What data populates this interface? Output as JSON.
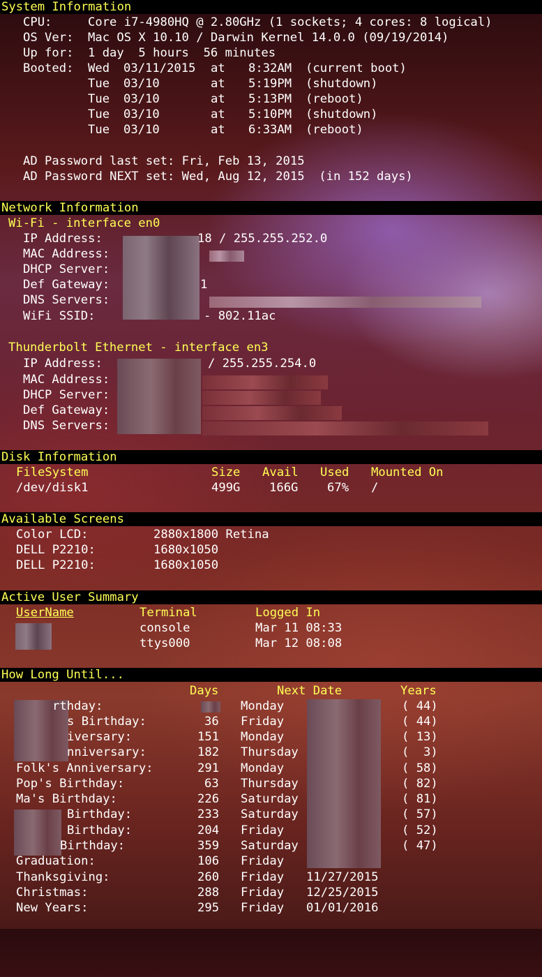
{
  "system": {
    "title": "System Information",
    "cpu_label": "CPU:",
    "cpu_value": "Core i7-4980HQ @ 2.80GHz (1 sockets; 4 cores: 8 logical)",
    "os_label": "OS Ver:",
    "os_value": "Mac OS X 10.10 / Darwin Kernel 14.0.0 (09/19/2014)",
    "up_label": "Up for:",
    "up_value": "1 day  5 hours  56 minutes",
    "booted_label": "Booted:",
    "boots": [
      {
        "day": "Wed",
        "date": "03/11/2015",
        "at": "at",
        "time": "8:32AM",
        "note": "(current boot)"
      },
      {
        "day": "Tue",
        "date": "03/10",
        "at": "at",
        "time": "5:19PM",
        "note": "(shutdown)"
      },
      {
        "day": "Tue",
        "date": "03/10",
        "at": "at",
        "time": "5:13PM",
        "note": "(reboot)"
      },
      {
        "day": "Tue",
        "date": "03/10",
        "at": "at",
        "time": "5:10PM",
        "note": "(shutdown)"
      },
      {
        "day": "Tue",
        "date": "03/10",
        "at": "at",
        "time": "6:33AM",
        "note": "(reboot)"
      }
    ],
    "ad_last": "AD Password last set: Fri, Feb 13, 2015",
    "ad_next": "AD Password NEXT set: Wed, Aug 12, 2015  (in 152 days)"
  },
  "network": {
    "title": "Network Information",
    "wifi_header": "Wi-Fi - interface en0",
    "wifi": {
      "ip_label": "IP Address:",
      "ip_value": "18 / 255.255.252.0",
      "mac_label": "MAC Address:",
      "dhcp_label": "DHCP Server:",
      "gw_label": "Def Gateway:",
      "gw_value": "1",
      "dns_label": "DNS Servers:",
      "ssid_label": "WiFi SSID:",
      "ssid_value": "- 802.11ac"
    },
    "eth_header": "Thunderbolt Ethernet - interface en3",
    "eth": {
      "ip_label": "IP Address:",
      "ip_value": "/ 255.255.254.0",
      "mac_label": "MAC Address:",
      "dhcp_label": "DHCP Server:",
      "gw_label": "Def Gateway:",
      "dns_label": "DNS Servers:"
    }
  },
  "disk": {
    "title": "Disk Information",
    "headers": {
      "fs": "FileSystem",
      "size": "Size",
      "avail": "Avail",
      "used": "Used",
      "mount": "Mounted On"
    },
    "row": {
      "fs": "/dev/disk1",
      "size": "499G",
      "avail": "166G",
      "used": "67%",
      "mount": "/"
    }
  },
  "screens": {
    "title": "Available Screens",
    "items": [
      {
        "name": "Color LCD:",
        "res": "2880x1800 Retina"
      },
      {
        "name": "DELL P2210:",
        "res": "1680x1050"
      },
      {
        "name": "DELL P2210:",
        "res": "1680x1050"
      }
    ]
  },
  "users": {
    "title": "Active User Summary",
    "headers": {
      "user": "UserName",
      "term": "Terminal",
      "login": "Logged In"
    },
    "rows": [
      {
        "term": "console",
        "login": "Mar 11 08:33"
      },
      {
        "term": "ttys000",
        "login": "Mar 12 08:08"
      }
    ]
  },
  "until": {
    "title": "How Long Until...",
    "headers": {
      "days": "Days",
      "next": "Next Date",
      "years": "Years"
    },
    "rows": [
      {
        "label": "rthday:",
        "days": "",
        "day": "Monday",
        "date": "",
        "years": "( 44)"
      },
      {
        "label": "s Birthday:",
        "days": "36",
        "day": "Friday",
        "date": "",
        "years": "( 44)"
      },
      {
        "label": "iversary:",
        "days": "151",
        "day": "Monday",
        "date": "",
        "years": "( 13)"
      },
      {
        "label": "nniversary:",
        "days": "182",
        "day": "Thursday",
        "date": "",
        "years": "(  3)"
      },
      {
        "label": "Folk's Anniversary:",
        "days": "291",
        "day": "Monday",
        "date": "",
        "years": "( 58)"
      },
      {
        "label": "Pop's Birthday:",
        "days": "63",
        "day": "Thursday",
        "date": "",
        "years": "( 82)"
      },
      {
        "label": "Ma's Birthday:",
        "days": "226",
        "day": "Saturday",
        "date": "",
        "years": "( 81)"
      },
      {
        "label": "Birthday:",
        "days": "233",
        "day": "Saturday",
        "date": "",
        "years": "( 57)"
      },
      {
        "label": "Birthday:",
        "days": "204",
        "day": "Friday",
        "date": "",
        "years": "( 52)"
      },
      {
        "label": "Birthday:",
        "days": "359",
        "day": "Saturday",
        "date": "",
        "years": "( 47)"
      },
      {
        "label": "Graduation:",
        "days": "106",
        "day": "Friday",
        "date": "",
        "years": ""
      },
      {
        "label": "Thanksgiving:",
        "days": "260",
        "day": "Friday",
        "date": "11/27/2015",
        "years": ""
      },
      {
        "label": "Christmas:",
        "days": "288",
        "day": "Friday",
        "date": "12/25/2015",
        "years": ""
      },
      {
        "label": "New Years:",
        "days": "295",
        "day": "Friday",
        "date": "01/01/2016",
        "years": ""
      }
    ]
  }
}
